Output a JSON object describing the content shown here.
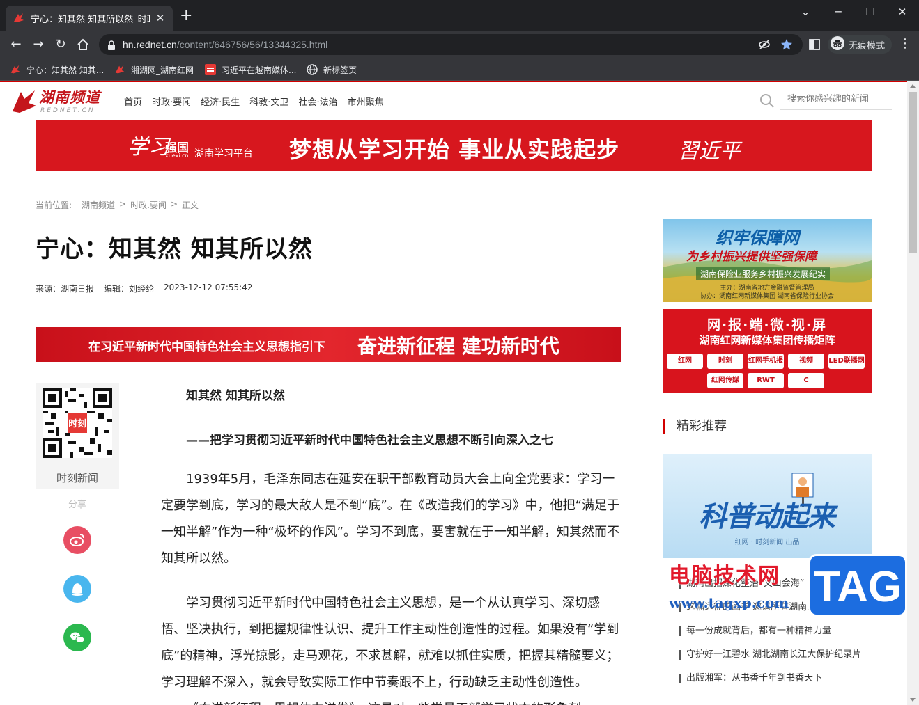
{
  "browser": {
    "tab_title": "宁心：知其然 知其所以然_时政要",
    "url_host": "hn.rednet.cn",
    "url_path": "/content/646756/56/13344325.html",
    "incognito_label": "无痕模式",
    "bookmarks": [
      {
        "label": "宁心：知其然 知其..."
      },
      {
        "label": "湘湖网_湖南红网"
      },
      {
        "label": "习近平在越南媒体..."
      },
      {
        "label": "新标签页"
      }
    ]
  },
  "site": {
    "logo_text": "湖南频道",
    "logo_sub": "REDNET.CN",
    "nav": [
      "首页",
      "时政·要闻",
      "经济·民生",
      "科教·文卫",
      "社会·法治",
      "市州聚焦"
    ],
    "search_placeholder": "搜索你感兴趣的新闻"
  },
  "top_banner": {
    "xuexi": "学习",
    "qiangguo": "强国",
    "domain": "xuexi.cn",
    "platform": "湖南学习平台",
    "slogan": "梦想从学习开始  事业从实践起步",
    "sign": "習近平"
  },
  "breadcrumb": {
    "label": "当前位置:",
    "items": [
      "湖南频道",
      ">",
      "时政.要闻",
      ">",
      "正文"
    ]
  },
  "article": {
    "title": "宁心：知其然 知其所以然",
    "source": "来源：湖南日报",
    "editor": "编辑：刘经纶",
    "datetime": "2023-12-12 07:55:42",
    "banner_small": "在习近平新时代中国特色社会主义思想指引下",
    "banner_big": "奋进新征程 建功新时代",
    "subhead1": "知其然 知其所以然",
    "subhead2": "——把学习贯彻习近平新时代中国特色社会主义思想不断引向深入之七",
    "para1": "1939年5月，毛泽东同志在延安在职干部教育动员大会上向全党要求：学习一定要学到底，学习的最大敌人是不到“底”。在《改造我们的学习》中，他把“满足于一知半解”作为一种“极坏的作风”。学习不到底，要害就在于一知半解，知其然而不知其所以然。",
    "para2": "学习贯彻习近平新时代中国特色社会主义思想，是一个从认真学习、深切感悟、坚决执行，到把握规律性认识、提升工作主动性创造性的过程。如果没有“学到底”的精神，浮光掠影，走马观花，不求甚解，就难以抓住实质，把握其精髓要义；学习理解不深入，就会导致实际工作中节奏跟不上，行动缺乏主动性创造性。",
    "para3": "《奋进新征程，思想伟力迸发》，这是对一些党员干部学习状态的形象刻"
  },
  "qr": {
    "label": "时刻新闻",
    "share_label": "—分享—"
  },
  "sidebar": {
    "ad1": {
      "t1": "织牢保障网",
      "t2": "为乡村振兴提供坚强保障",
      "t3": "湖南保险业服务乡村振兴发展纪实",
      "t4": "主办：湖南省地方金融监督管理局",
      "t5": "协办：湖南红网新媒体集团  湖南省保险行业协会"
    },
    "ad2": {
      "t1": "网·报·端·微·视·屏",
      "t2": "湖南红网新媒体集团传播矩阵",
      "logos": [
        "红网",
        "时刻",
        "红网手机报",
        "视频",
        "LED联播网",
        "红网传媒",
        "RWT",
        "C"
      ]
    },
    "rec_head": "精彩推荐",
    "rec_img_title": "科普动起来",
    "rec_img_sub": "红网 · 时刻新闻 出品",
    "rec_items": [
      "湖南出招深化整治“文山会海”",
      "这幅远征的画卷 邀请所有湖南人一起入画",
      "每一份成就背后，都有一种精神力量",
      "守护好一江碧水 湖北湖南长江大保护纪录片",
      "出版湘军：从书香千年到书香天下"
    ]
  },
  "watermark": {
    "t1": "电脑技术网",
    "t2": "www.tagxp.com",
    "tag": "TAG"
  },
  "colors": {
    "brand_red": "#d7171e",
    "chrome_dark": "#202124",
    "chrome_mid": "#35363a"
  }
}
